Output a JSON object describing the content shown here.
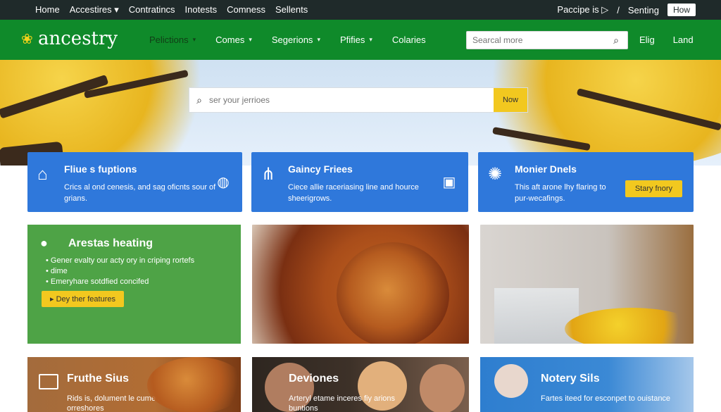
{
  "topbar": {
    "nav": [
      "Home",
      "Accestires ▾",
      "Contratincs",
      "Inotests",
      "Comness",
      "Sellents"
    ],
    "right_items": [
      "Paccipe is ▷",
      "/",
      "Senting"
    ],
    "how_label": "How"
  },
  "header": {
    "logo_text": "ancestry",
    "nav": [
      {
        "label": "Pelictions",
        "caret": "▾",
        "dim": true
      },
      {
        "label": "Comes",
        "caret": "▾"
      },
      {
        "label": "Segerions",
        "caret": "▾"
      },
      {
        "label": "Pfifies",
        "caret": "▾"
      },
      {
        "label": "Colaries",
        "caret": ""
      }
    ],
    "search_placeholder": "Searcal more",
    "links": [
      "Elig",
      "Land"
    ]
  },
  "hero": {
    "search_placeholder": "ser your jerrioes",
    "search_button": "Now"
  },
  "cards": [
    {
      "title": "Fliue s fuptions",
      "desc": "Crics al ond cenesis, and sag oficnts sour of grians."
    },
    {
      "title": "Gaincy Friees",
      "desc": "Ciece allie raceriasing line and hource sheerigrows."
    },
    {
      "title": "Monier Dnels",
      "desc": "This aft arone lhy flaring to pur-wecafings.",
      "cta": "Stary fnory"
    }
  ],
  "green_card": {
    "title": "Arestas heating",
    "items": [
      "Gener evalty our acty ory in criping rortefs",
      "dime",
      "Emeryhare sotdfied concifed"
    ],
    "button": "Dey ther features"
  },
  "bottom_cards": [
    {
      "title": "Fruthe Sius",
      "desc": "Rids is, dolument le cume for orreshores"
    },
    {
      "title": "Deviones",
      "desc": "Arteryl etame inceres fiy arions buntions"
    },
    {
      "title": "Notery Sils",
      "desc": "Fartes iteed for esconpet to ouistance"
    }
  ],
  "colors": {
    "topbar": "#1f2a2a",
    "header_green": "#0f8a2a",
    "card_blue": "#2f78db",
    "accent_yellow": "#f2c81f",
    "green_card": "#4ea346"
  }
}
